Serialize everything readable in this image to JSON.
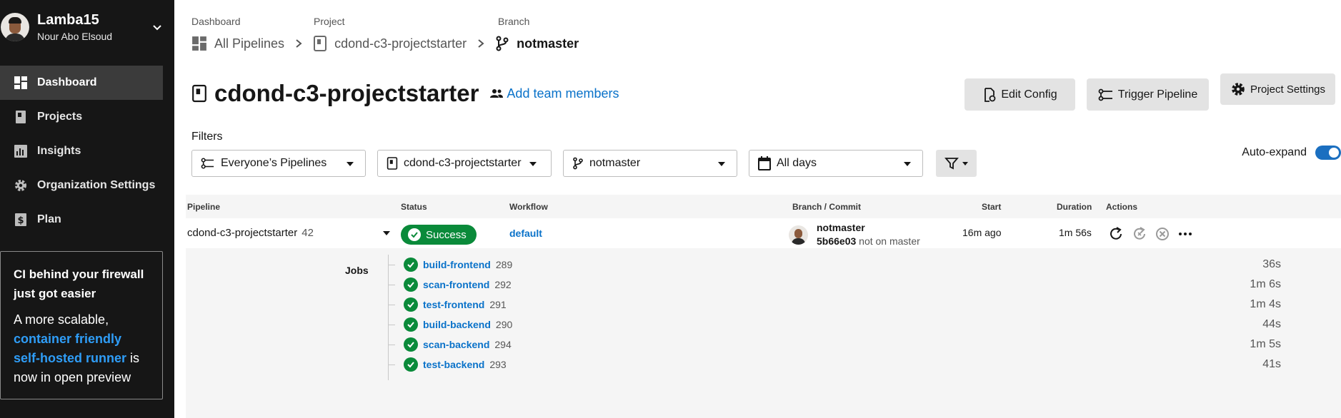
{
  "sidebar": {
    "org_name": "Lamba15",
    "user_name": "Nour Abo Elsoud",
    "items": [
      {
        "label": "Dashboard",
        "icon": "dashboard-icon",
        "active": true
      },
      {
        "label": "Projects",
        "icon": "projects-icon"
      },
      {
        "label": "Insights",
        "icon": "insights-icon"
      },
      {
        "label": "Organization Settings",
        "icon": "gear-icon"
      },
      {
        "label": "Plan",
        "icon": "dollar-icon"
      }
    ],
    "promo": {
      "title": "CI behind your firewall just got easier",
      "body_before": "A more scalable, ",
      "link": "container friendly self-hosted runner",
      "body_after": " is now in open preview"
    }
  },
  "breadcrumbs": {
    "labels": [
      "Dashboard",
      "Project",
      "Branch"
    ],
    "items": [
      "All Pipelines",
      "cdond-c3-projectstarter",
      "notmaster"
    ]
  },
  "header": {
    "title": "cdond-c3-projectstarter",
    "add_team": "Add team members",
    "edit_config": "Edit Config",
    "trigger_pipeline": "Trigger Pipeline",
    "project_settings": "Project Settings"
  },
  "filters": {
    "label": "Filters",
    "pipelines": "Everyone’s Pipelines",
    "project": "cdond-c3-projectstarter",
    "branch": "notmaster",
    "days": "All days",
    "auto_expand": "Auto-expand",
    "auto_expand_on": true
  },
  "table": {
    "headers": [
      "Pipeline",
      "Status",
      "Workflow",
      "Branch / Commit",
      "Start",
      "Duration",
      "Actions"
    ],
    "pipeline": {
      "name": "cdond-c3-projectstarter",
      "number": "42",
      "status": "Success",
      "workflow": "default",
      "branch": "notmaster",
      "commit": "5b66e03",
      "commit_note": "not on master",
      "start": "16m ago",
      "duration": "1m 56s"
    },
    "jobs_label": "Jobs",
    "jobs": [
      {
        "name": "build-frontend",
        "number": "289",
        "duration": "36s"
      },
      {
        "name": "scan-frontend",
        "number": "292",
        "duration": "1m 6s"
      },
      {
        "name": "test-frontend",
        "number": "291",
        "duration": "1m 4s"
      },
      {
        "name": "build-backend",
        "number": "290",
        "duration": "44s"
      },
      {
        "name": "scan-backend",
        "number": "294",
        "duration": "1m 5s"
      },
      {
        "name": "test-backend",
        "number": "293",
        "duration": "41s"
      }
    ]
  },
  "colors": {
    "sidebar_bg": "#161616",
    "success": "#0a8a3a",
    "link": "#0a72c9",
    "toggle": "#1b6fc0"
  }
}
